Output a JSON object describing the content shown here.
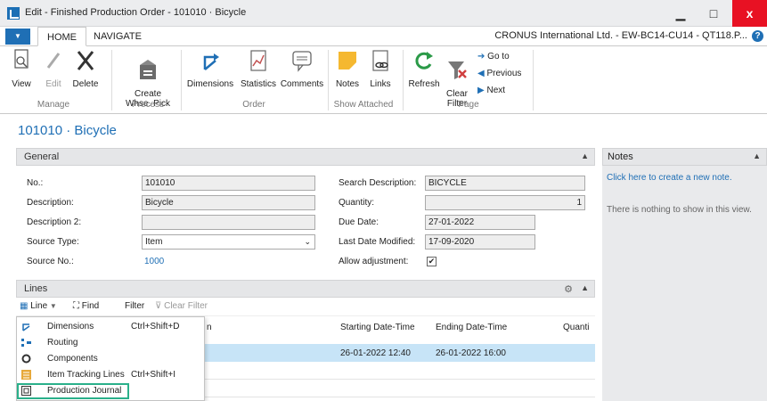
{
  "window": {
    "title": "Edit - Finished Production Order - 101010 · Bicycle",
    "min": "▁",
    "max": "□",
    "close": "x"
  },
  "menu": {
    "dropdown_glyph": "▼",
    "tabs": [
      "HOME",
      "NAVIGATE"
    ],
    "company": "CRONUS International Ltd. - EW-BC14-CU14 - QT118.P...",
    "help": "?"
  },
  "ribbon": {
    "manage": {
      "label": "Manage",
      "view": "View",
      "edit": "Edit",
      "delete": "Delete"
    },
    "process": {
      "label": "Process",
      "create_whse_pick": "Create\nWhse. Pick"
    },
    "order": {
      "label": "Order",
      "dimensions": "Dimensions",
      "statistics": "Statistics",
      "comments": "Comments"
    },
    "show_attached": {
      "label": "Show Attached",
      "notes": "Notes",
      "links": "Links"
    },
    "page": {
      "label": "Page",
      "refresh": "Refresh",
      "clear_filter": "Clear\nFilter",
      "go_to": "Go to",
      "previous": "Previous",
      "next": "Next"
    }
  },
  "page_title": "101010 · Bicycle",
  "general": {
    "header": "General",
    "no_label": "No.:",
    "no_value": "101010",
    "description_label": "Description:",
    "description_value": "Bicycle",
    "description2_label": "Description 2:",
    "description2_value": "",
    "source_type_label": "Source Type:",
    "source_type_value": "Item",
    "source_no_label": "Source No.:",
    "source_no_value": "1000",
    "search_description_label": "Search Description:",
    "search_description_value": "BICYCLE",
    "quantity_label": "Quantity:",
    "quantity_value": "1",
    "due_date_label": "Due Date:",
    "due_date_value": "27-01-2022",
    "last_date_modified_label": "Last Date Modified:",
    "last_date_modified_value": "17-09-2020",
    "allow_adjustment_label": "Allow adjustment:",
    "allow_adjustment_checked": true,
    "check_glyph": "✔"
  },
  "notes": {
    "header": "Notes",
    "create_link": "Click here to create a new note.",
    "empty": "There is nothing to show in this view."
  },
  "lines": {
    "header": "Lines",
    "toolbar": {
      "line": "Line",
      "find": "Find",
      "filter": "Filter",
      "clear_filter": "Clear Filter"
    },
    "columns": {
      "partial": "n",
      "starting": "Starting Date-Time",
      "ending": "Ending Date-Time",
      "quantity": "Quanti"
    },
    "row": {
      "starting": "26-01-2022 12:40",
      "ending": "26-01-2022 16:00"
    },
    "menu_items": [
      {
        "label": "Dimensions",
        "shortcut": "Ctrl+Shift+D",
        "icon": "dimensions-icon"
      },
      {
        "label": "Routing",
        "shortcut": "",
        "icon": "routing-icon"
      },
      {
        "label": "Components",
        "shortcut": "",
        "icon": "components-icon"
      },
      {
        "label": "Item Tracking Lines",
        "shortcut": "Ctrl+Shift+I",
        "icon": "item-tracking-icon"
      },
      {
        "label": "Production Journal",
        "shortcut": "",
        "icon": "production-journal-icon"
      }
    ]
  },
  "colors": {
    "accent": "#1f6fb5",
    "selection": "#c7e4f7",
    "highlight_border": "#2ab08a"
  }
}
